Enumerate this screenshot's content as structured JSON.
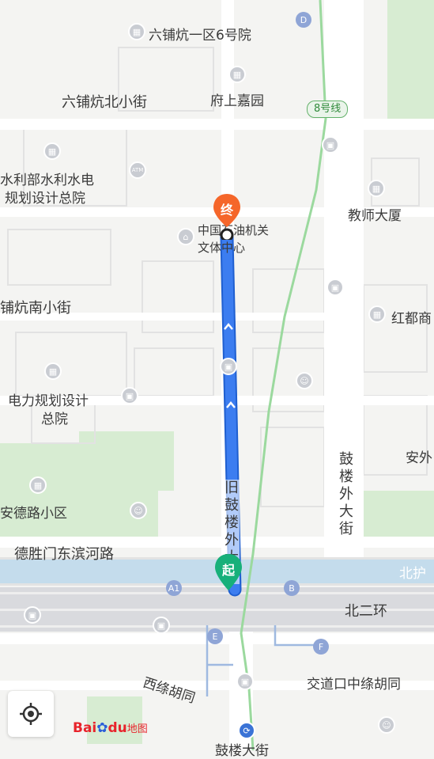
{
  "map": {
    "places": {
      "liupukeng_yiqu": "六铺炕一区6号院",
      "fushang_jiayuan": "府上嘉园",
      "liupukang_beixiaojie": "六铺炕北小街",
      "shuili_line1": "水利部水利水电",
      "shuili_line2": "规划设计总院",
      "jiaoshi_dasha": "教师大厦",
      "zhongguo_shiyou_line1": "中国石油机关",
      "zhongguo_shiyou_line2": "文体中心",
      "liupukang_nanxiaojie": "铺炕南小街",
      "hongdu": "红都商",
      "dianli_line1": "电力规划设计",
      "dianli_line2": "总院",
      "anwai": "安外",
      "andelu_xiaoqu": "安德路小区",
      "desheng_dongbinhe": "德胜门东滨河路",
      "beihu": "北护",
      "beierhuan": "北二环",
      "xixu_hutong": "西绦胡同",
      "jiaodaokou_zhongxu": "交道口中绦胡同",
      "gulou_dajie": "鼓楼大街"
    },
    "roads": {
      "jiu_gulou_waidajie": "旧鼓楼外大街",
      "gulou_waidajie": "鼓楼外大街"
    },
    "metro_line": "8号线",
    "metro_exits": [
      "D",
      "A1",
      "B",
      "E",
      "F"
    ],
    "markers": {
      "start": "起",
      "end": "终"
    },
    "logo": {
      "bai": "Bai",
      "du": "du",
      "ditu": "地图"
    },
    "colors": {
      "route": "#3c7df0",
      "start": "#17b07a",
      "end": "#f5662a",
      "metro": "#9bd99e"
    }
  }
}
